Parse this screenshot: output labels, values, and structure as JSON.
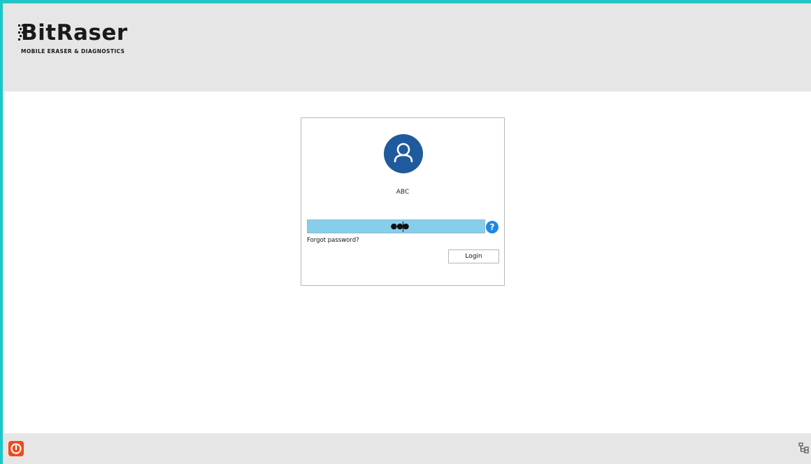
{
  "app": {
    "logo_text": "BitRaser",
    "logo_subtitle": "MOBILE ERASER & DIAGNOSTICS"
  },
  "login": {
    "username": "ABC",
    "password_masked": "●●●",
    "help_label": "?",
    "forgot_password": "Forgot password?",
    "login_button": "Login"
  },
  "colors": {
    "accent_border": "#19c8c8",
    "avatar_bg": "#1f5a9c",
    "password_field_bg": "#87ceeb",
    "help_button": "#1e88e5",
    "power_button": "#f04a1a"
  },
  "icons": {
    "avatar": "user-icon",
    "help": "help-icon",
    "power": "power-icon",
    "network": "network-icon"
  }
}
